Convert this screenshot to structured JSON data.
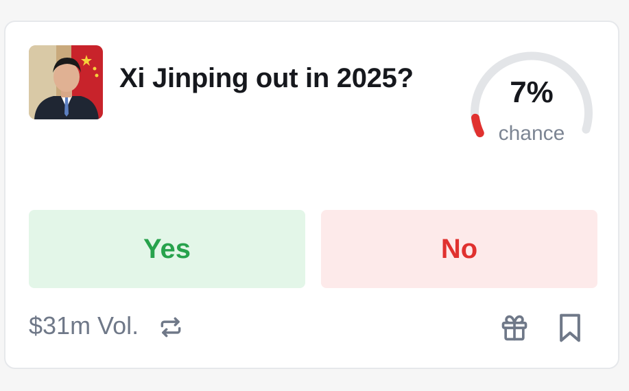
{
  "market": {
    "title": "Xi Jinping out in 2025?",
    "chance_percent": "7%",
    "chance_value": 0.07,
    "chance_label": "chance",
    "thumbnail_icon": "portrait-photo"
  },
  "actions": {
    "yes_label": "Yes",
    "no_label": "No"
  },
  "footer": {
    "volume": "$31m Vol.",
    "icons": [
      "repeat-icon",
      "gift-icon",
      "bookmark-icon"
    ]
  },
  "colors": {
    "yes_bg": "#e3f6e8",
    "yes_text": "#27a24c",
    "no_bg": "#fdeaea",
    "no_text": "#e0312f",
    "gauge_track": "#e3e5e8",
    "gauge_fill": "#e0312f"
  }
}
